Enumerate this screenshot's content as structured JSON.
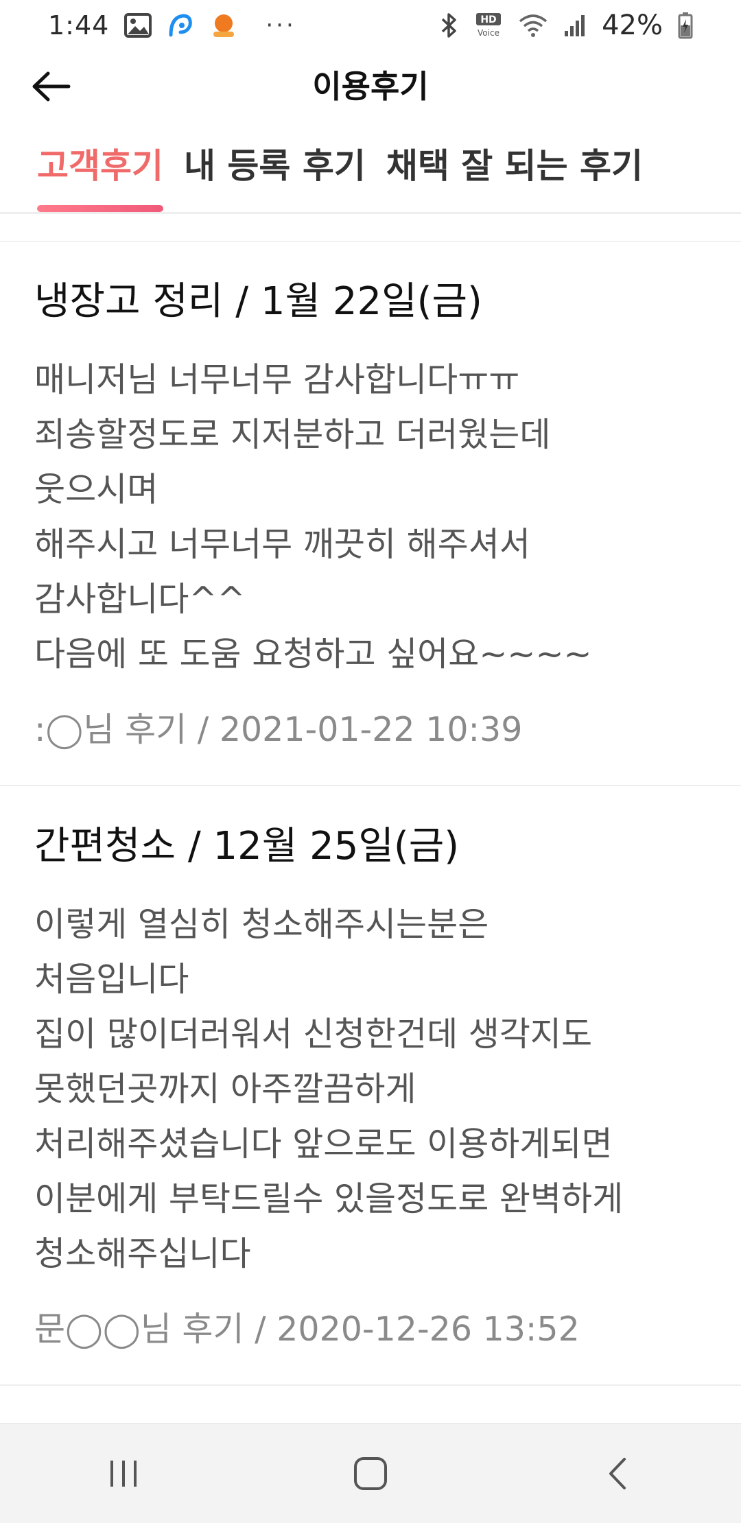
{
  "status_bar": {
    "time": "1:44",
    "battery_text": "42%",
    "icons": [
      "gallery-icon",
      "app-notification-icon",
      "app-notification-icon-2",
      "more-icon",
      "bluetooth-icon",
      "hd-voice-icon",
      "wifi-icon",
      "signal-icon",
      "battery-icon"
    ],
    "hd_label": "HD",
    "voice_label": "Voice",
    "more": "···"
  },
  "header": {
    "title": "이용후기",
    "back_icon": "arrow-left-icon"
  },
  "tabs": [
    {
      "label": "고객후기",
      "active": true
    },
    {
      "label": "내 등록 후기",
      "active": false
    },
    {
      "label": "채택 잘 되는 후기",
      "active": false
    }
  ],
  "colors": {
    "accent": "#f06a6a",
    "underline_start": "#ff7a8a",
    "underline_end": "#f05a7a",
    "body_text": "#555555",
    "meta_text": "#8a8a8a"
  },
  "reviews": [
    {
      "title": "냉장고 정리 / 1월 22일(금)",
      "lines": [
        "매니저님 너무너무 감사합니다ㅠㅠ",
        "죄송할정도로 지저분하고 더러웠는데",
        "웃으시며",
        "해주시고 너무너무 깨끗히 해주셔서",
        "감사합니다^^",
        "다음에 또 도움 요청하고 싶어요~~~~"
      ],
      "meta": ":◯님 후기 / 2021-01-22 10:39"
    },
    {
      "title": "간편청소 / 12월 25일(금)",
      "lines": [
        "이렇게 열심히 청소해주시는분은",
        "처음입니다",
        "집이 많이더러워서 신청한건데 생각지도",
        "못했던곳까지 아주깔끔하게",
        "처리해주셨습니다 앞으로도 이용하게되면",
        "이분에게 부탁드릴수 있을정도로 완벽하게",
        "청소해주십니다"
      ],
      "meta": "문◯◯님 후기 / 2020-12-26 13:52"
    }
  ],
  "nav_bar": {
    "buttons": [
      "recent-apps-icon",
      "home-icon",
      "back-icon"
    ]
  }
}
